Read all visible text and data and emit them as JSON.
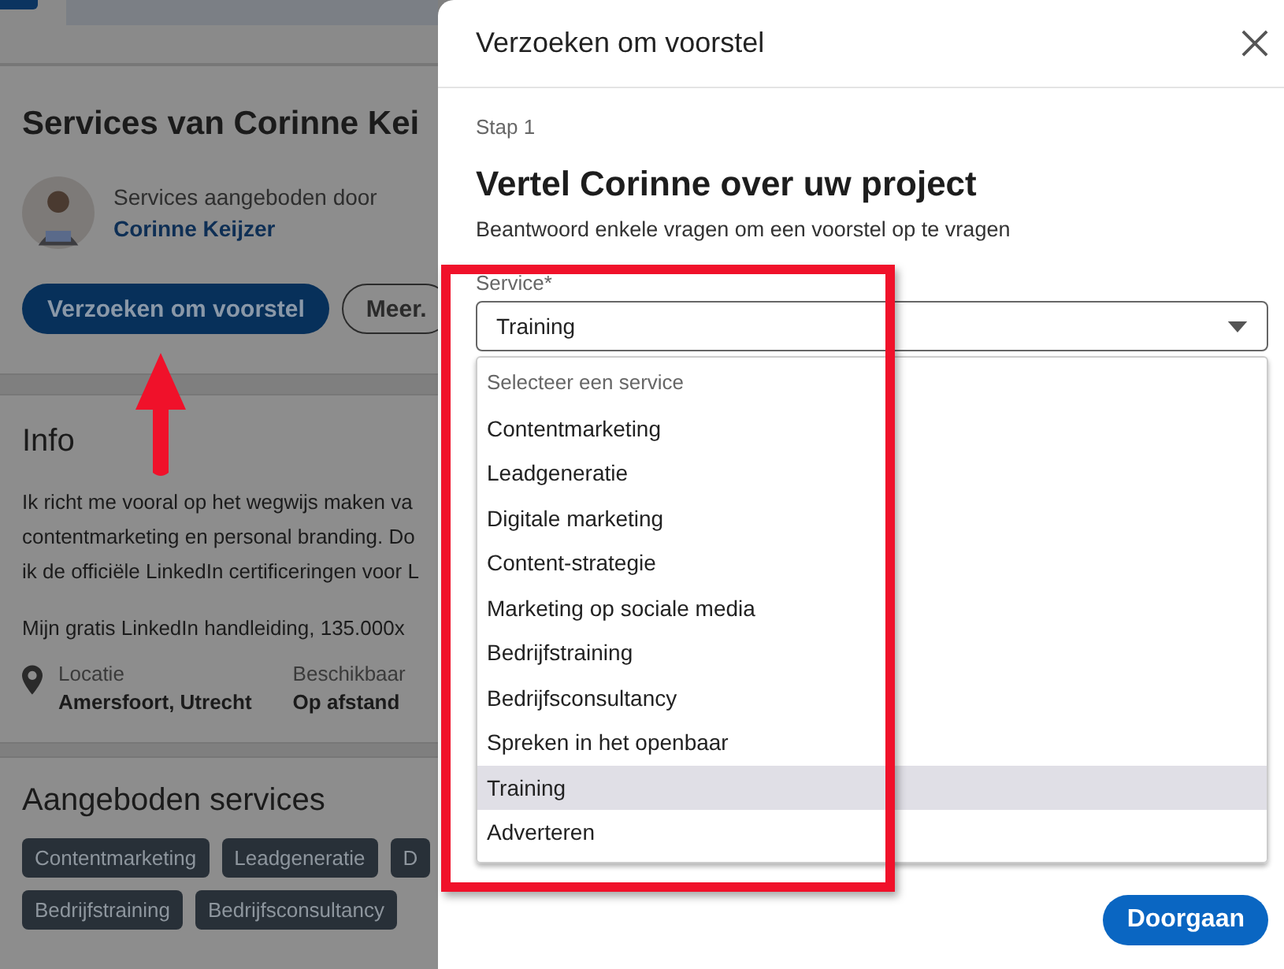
{
  "page": {
    "title": "Services van Corinne Kei",
    "provider_label": "Services aangeboden door",
    "provider_name": "Corinne Keijzer",
    "buttons": [
      {
        "label": "Verzoeken om voorstel",
        "kind": "primary"
      },
      {
        "label": "Meer.",
        "kind": "secondary"
      }
    ],
    "info": {
      "title": "Info",
      "lines": [
        "Ik richt me vooral op het wegwijs maken va",
        "contentmarketing en personal branding. Do",
        "ik de officiële LinkedIn certificeringen voor L"
      ],
      "extra": "Mijn gratis LinkedIn handleiding, 135.000x",
      "facts": [
        {
          "label": "Locatie",
          "value": "Amersfoort, Utrecht",
          "kind": "location"
        },
        {
          "label": "Beschikbaar",
          "value": "Op afstand",
          "kind": "plain"
        }
      ]
    },
    "services": {
      "title": "Aangeboden services",
      "tag_rows": [
        [
          "Contentmarketing",
          "Leadgeneratie",
          "D"
        ],
        [
          "Bedrijfstraining",
          "Bedrijfsconsultancy"
        ]
      ]
    }
  },
  "modal": {
    "title": "Verzoeken om voorstel",
    "step": "Stap 1",
    "heading": "Vertel Corinne over uw project",
    "subtitle": "Beantwoord enkele vragen om een voorstel op te vragen",
    "field_label": "Service*",
    "field_value": "Training",
    "options": [
      {
        "label": "Selecteer een service",
        "kind": "placeholder",
        "selected": false
      },
      {
        "label": "Contentmarketing",
        "kind": "option",
        "selected": false
      },
      {
        "label": "Leadgeneratie",
        "kind": "option",
        "selected": false
      },
      {
        "label": "Digitale marketing",
        "kind": "option",
        "selected": false
      },
      {
        "label": "Content-strategie",
        "kind": "option",
        "selected": false
      },
      {
        "label": "Marketing op sociale media",
        "kind": "option",
        "selected": false
      },
      {
        "label": "Bedrijfstraining",
        "kind": "option",
        "selected": false
      },
      {
        "label": "Bedrijfsconsultancy",
        "kind": "option",
        "selected": false
      },
      {
        "label": "Spreken in het openbaar",
        "kind": "option",
        "selected": false
      },
      {
        "label": "Training",
        "kind": "option",
        "selected": true
      },
      {
        "label": "Adverteren",
        "kind": "option",
        "selected": false
      }
    ],
    "continue_button": "Doorgaan"
  },
  "annotations": {
    "arrow": true,
    "frame": true
  }
}
